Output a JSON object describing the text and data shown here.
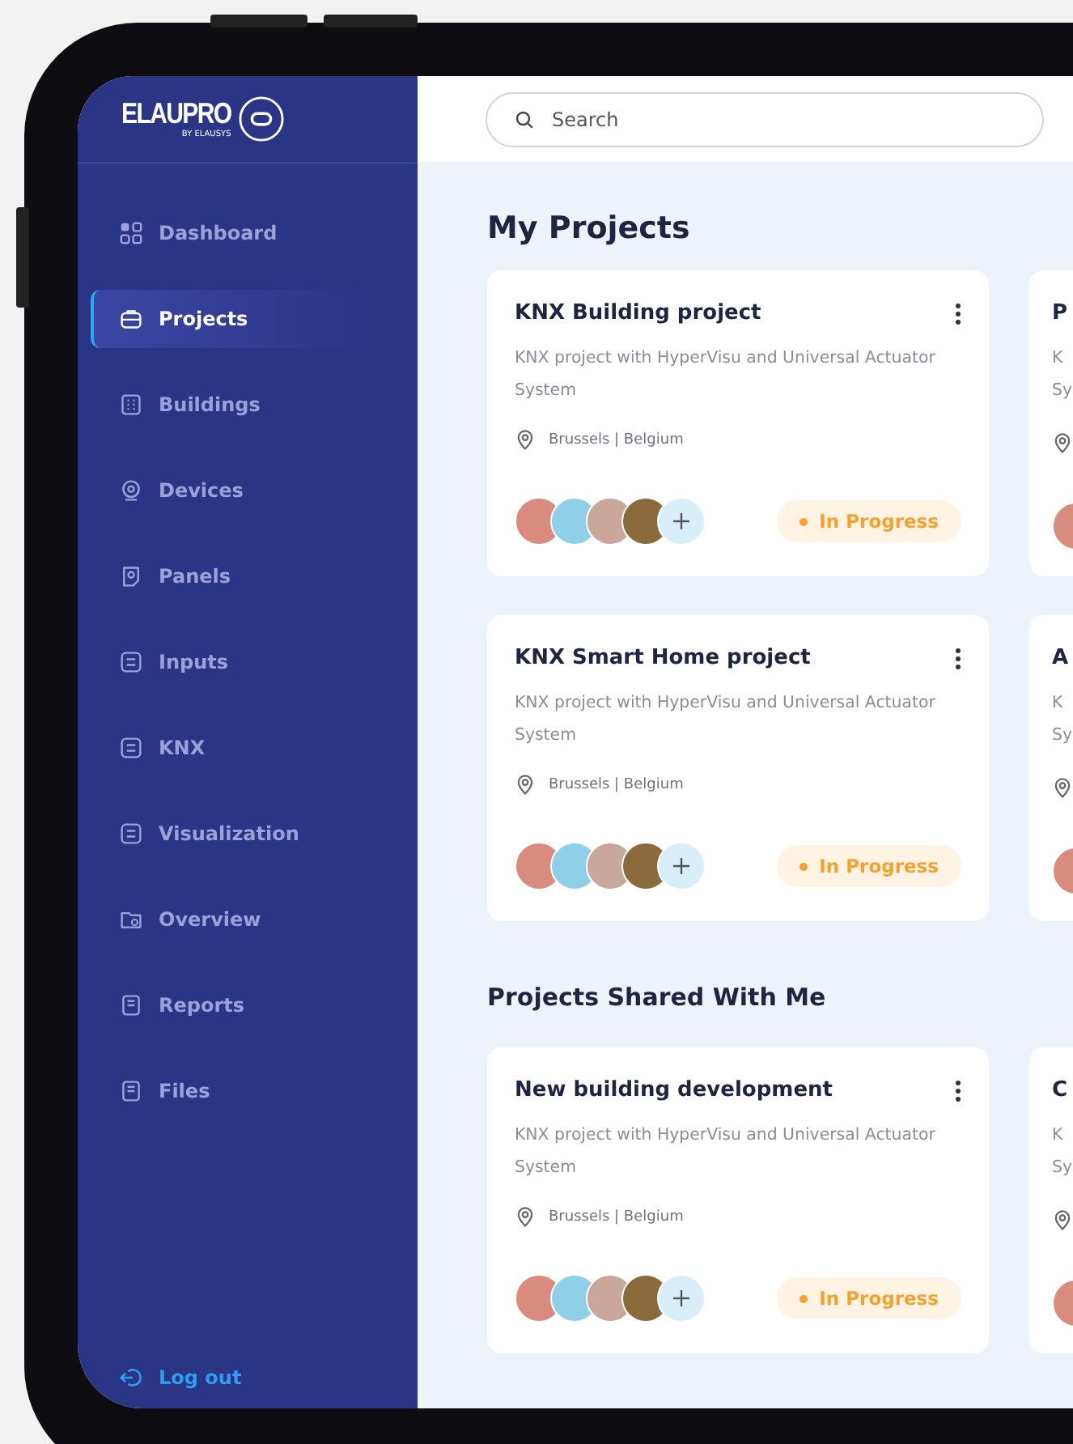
{
  "logo": {
    "name": "ELAUPRO",
    "tagline": "BY ELAUSYS"
  },
  "sidebar": {
    "items": [
      {
        "label": "Dashboard",
        "selected": false
      },
      {
        "label": "Projects",
        "selected": true
      },
      {
        "label": "Buildings",
        "selected": false
      },
      {
        "label": "Devices",
        "selected": false
      },
      {
        "label": "Panels",
        "selected": false
      },
      {
        "label": "Inputs",
        "selected": false
      },
      {
        "label": "KNX",
        "selected": false
      },
      {
        "label": "Visualization",
        "selected": false
      },
      {
        "label": "Overview",
        "selected": false
      },
      {
        "label": "Reports",
        "selected": false
      },
      {
        "label": "Files",
        "selected": false
      }
    ],
    "logout": "Log out"
  },
  "search": {
    "placeholder": "Search"
  },
  "sections": [
    {
      "title": "My Projects",
      "cards": [
        {
          "kind": "full",
          "title": "KNX Building project",
          "description_lines": [
            "KNX project with HyperVisu and Universal Actuator",
            "System"
          ],
          "location": "Brussels | Belgium",
          "status": "In Progress"
        },
        {
          "kind": "cut",
          "title": "P",
          "description_lines": [
            "K",
            "Sy"
          ]
        },
        {
          "kind": "full",
          "title": "KNX Smart Home project",
          "description_lines": [
            "KNX project with HyperVisu and Universal Actuator",
            "System"
          ],
          "location": "Brussels | Belgium",
          "status": "In Progress"
        },
        {
          "kind": "cut",
          "title": "A",
          "description_lines": [
            "K",
            "Sy"
          ]
        }
      ]
    },
    {
      "title": "Projects Shared With Me",
      "cards": [
        {
          "kind": "full",
          "title": "New building development",
          "description_lines": [
            "KNX project with HyperVisu and Universal Actuator",
            "System"
          ],
          "location": "Brussels | Belgium",
          "status": "In Progress"
        },
        {
          "kind": "cut",
          "title": "C",
          "description_lines": [
            "K",
            "Sy"
          ]
        }
      ]
    }
  ]
}
